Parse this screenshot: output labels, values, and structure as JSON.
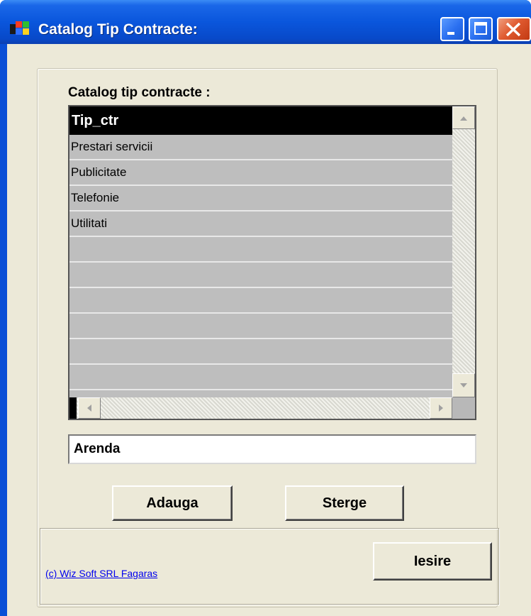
{
  "window": {
    "title": "Catalog Tip Contracte:"
  },
  "catalog": {
    "label": "Catalog tip contracte :",
    "column_header": "Tip_ctr",
    "rows": [
      "Prestari servicii",
      "Publicitate",
      "Telefonie",
      "Utilitati",
      "",
      "",
      "",
      "",
      "",
      "",
      ""
    ]
  },
  "input": {
    "value": "Arenda"
  },
  "buttons": {
    "add": "Adauga",
    "delete": "Sterge",
    "exit": "Iesire"
  },
  "footer": {
    "credit": "(c) Wiz Soft SRL Fagaras"
  },
  "colors": {
    "titlebar": "#0a56dc",
    "client_bg": "#ece9d8",
    "grid_header": "#000000",
    "grid_rows": "#bebebe",
    "link": "#0000ee",
    "close_button": "#e05a30"
  }
}
